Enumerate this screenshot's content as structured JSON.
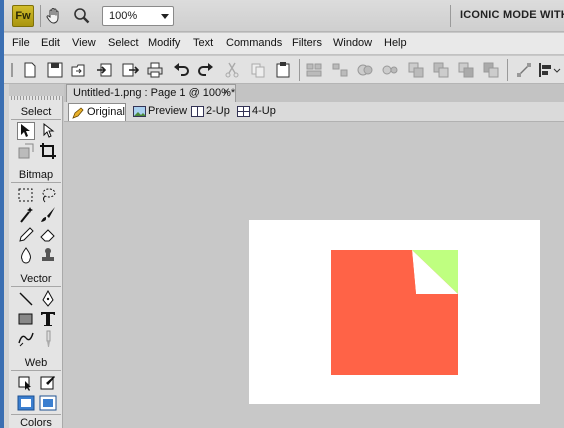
{
  "app": {
    "logo_text": "Fw",
    "zoom_value": "100%",
    "mode_title": "ICONIC MODE WITH P"
  },
  "menu": {
    "items": [
      "File",
      "Edit",
      "View",
      "Select",
      "Modify",
      "Text",
      "Commands",
      "Filters",
      "Window",
      "Help"
    ]
  },
  "document": {
    "tab_title": "Untitled-1.png : Page 1 @ 100%*",
    "close_glyph": "×"
  },
  "view_tabs": {
    "original": "Original",
    "preview": "Preview",
    "two_up": "2-Up",
    "four_up": "4-Up"
  },
  "tools_panel": {
    "select": "Select",
    "bitmap": "Bitmap",
    "vector": "Vector",
    "web": "Web",
    "colors": "Colors"
  },
  "icons": {
    "topbar": [
      "hand-icon",
      "zoom-icon"
    ],
    "main_toolbar": [
      "new-icon",
      "save-icon",
      "open-icon",
      "import-icon",
      "export-icon",
      "print-icon",
      "undo-icon",
      "redo-icon",
      "cut-icon",
      "copy-icon",
      "paste-icon",
      "group-icon",
      "ungroup-icon",
      "join-icon",
      "split-icon",
      "bring-front-icon",
      "bring-forward-icon",
      "send-backward-icon",
      "send-back-icon",
      "transform-icon",
      "align-icon"
    ]
  },
  "canvas": {
    "page_color": "#ffffff",
    "square_color": "#ff6347",
    "fold_color": "#bfff80"
  }
}
